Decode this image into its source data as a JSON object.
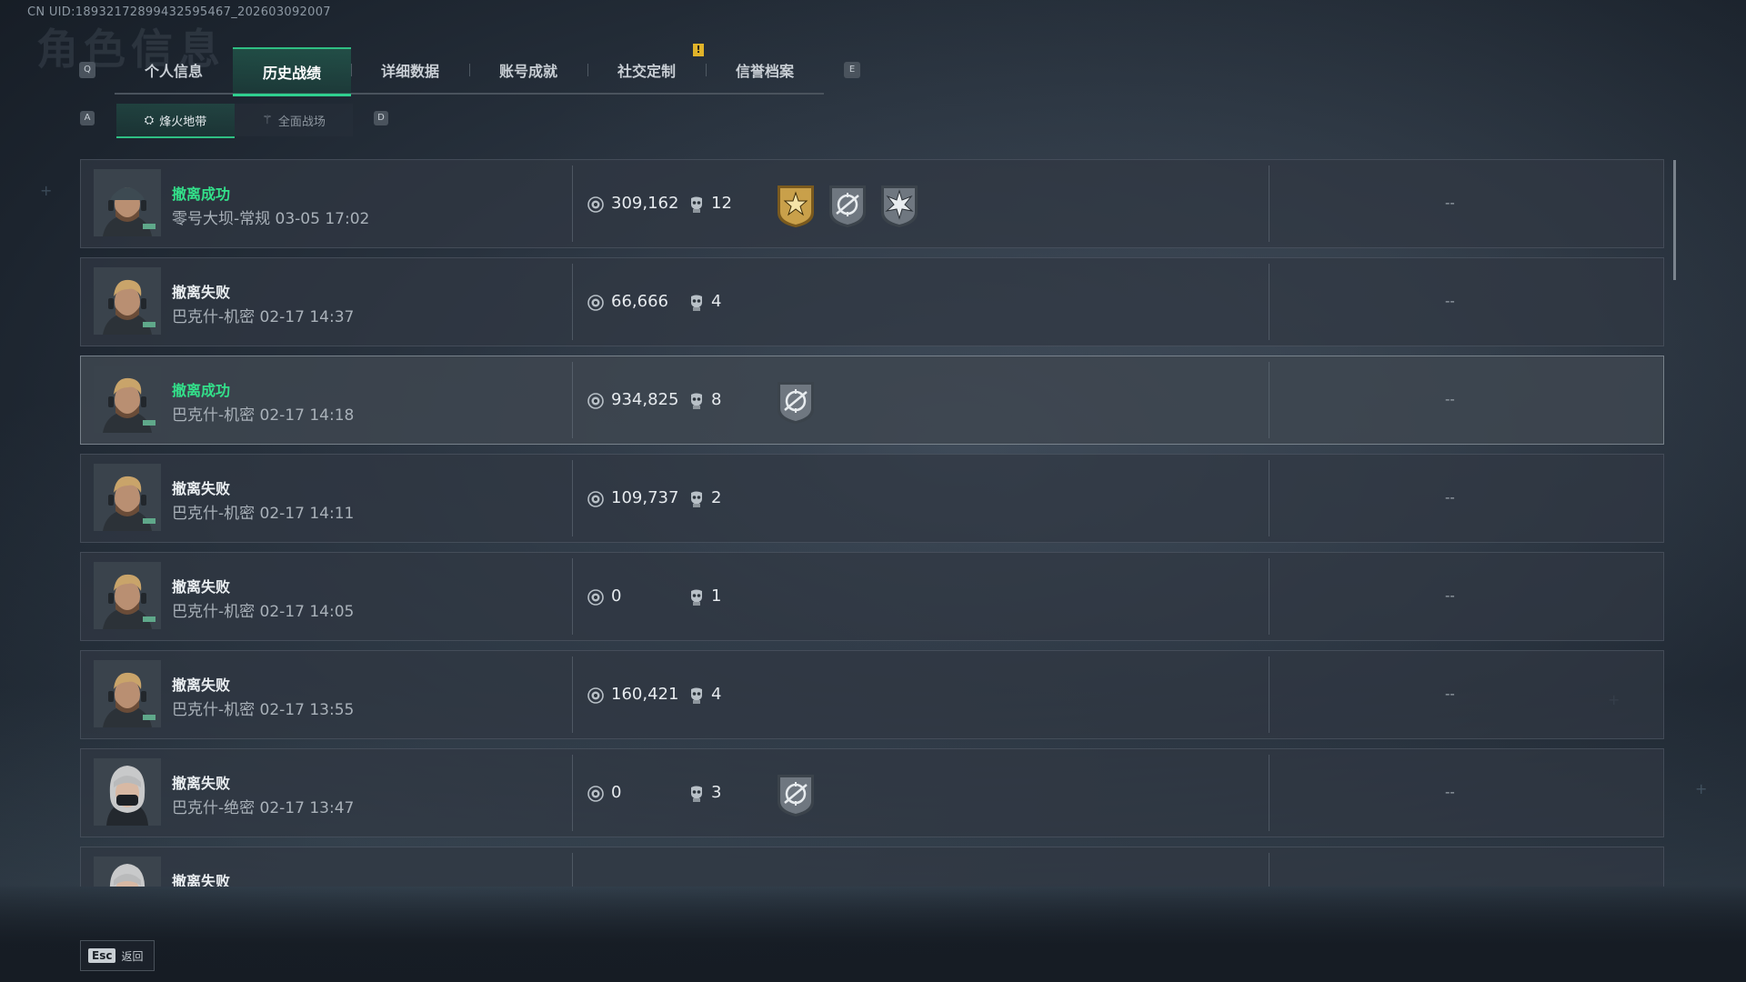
{
  "uid_text": "CN UID:18932172899432595467_202603092007",
  "bg_title": "角色信息",
  "keys": {
    "prev_tab": "Q",
    "next_tab": "E",
    "prev_sub": "A",
    "next_sub": "D"
  },
  "notice_badge": "!",
  "tabs": [
    {
      "label": "个人信息",
      "active": false
    },
    {
      "label": "历史战绩",
      "active": true
    },
    {
      "label": "详细数据",
      "active": false
    },
    {
      "label": "账号成就",
      "active": false
    },
    {
      "label": "社交定制",
      "active": false
    },
    {
      "label": "信誉档案",
      "active": false
    }
  ],
  "subtabs": [
    {
      "label": "烽火地带",
      "icon": "fire-zone-icon",
      "active": true
    },
    {
      "label": "全面战场",
      "icon": "battlefield-icon",
      "active": false
    }
  ],
  "colors": {
    "accent_green": "#2fbf83",
    "success_text": "#33e08a",
    "badge_gold": "#c9a04a",
    "badge_gray": "#6f7780"
  },
  "records": [
    {
      "status": "撤离成功",
      "success": true,
      "map": "零号大坝-常规 03-05 17:02",
      "value": "309,162",
      "kills": "12",
      "badges": [
        "gold-star-badge",
        "gray-crosshair-badge",
        "gray-burst-badge"
      ],
      "extra": "--",
      "avatar": "male-cap-operator",
      "highlight": false
    },
    {
      "status": "撤离失败",
      "success": false,
      "map": "巴克什-机密 02-17 14:37",
      "value": "66,666",
      "kills": "4",
      "badges": [],
      "extra": "--",
      "avatar": "male-blond-operator",
      "highlight": false
    },
    {
      "status": "撤离成功",
      "success": true,
      "map": "巴克什-机密 02-17 14:18",
      "value": "934,825",
      "kills": "8",
      "badges": [
        "gray-crosshair-badge"
      ],
      "extra": "--",
      "avatar": "male-blond-operator",
      "highlight": true
    },
    {
      "status": "撤离失败",
      "success": false,
      "map": "巴克什-机密 02-17 14:11",
      "value": "109,737",
      "kills": "2",
      "badges": [],
      "extra": "--",
      "avatar": "male-blond-operator",
      "highlight": false
    },
    {
      "status": "撤离失败",
      "success": false,
      "map": "巴克什-机密 02-17 14:05",
      "value": "0",
      "kills": "1",
      "badges": [],
      "extra": "--",
      "avatar": "male-blond-operator",
      "highlight": false
    },
    {
      "status": "撤离失败",
      "success": false,
      "map": "巴克什-机密 02-17 13:55",
      "value": "160,421",
      "kills": "4",
      "badges": [],
      "extra": "--",
      "avatar": "male-blond-operator",
      "highlight": false
    },
    {
      "status": "撤离失败",
      "success": false,
      "map": "巴克什-绝密 02-17 13:47",
      "value": "0",
      "kills": "3",
      "badges": [
        "gray-crosshair-badge"
      ],
      "extra": "--",
      "avatar": "female-masked-operator",
      "highlight": false
    },
    {
      "status": "撤离失败",
      "success": false,
      "map": "",
      "value": "",
      "kills": "",
      "badges": [],
      "extra": "",
      "avatar": "female-masked-operator",
      "highlight": false
    }
  ],
  "footer": {
    "esc_key": "Esc",
    "back_label": "返回"
  }
}
